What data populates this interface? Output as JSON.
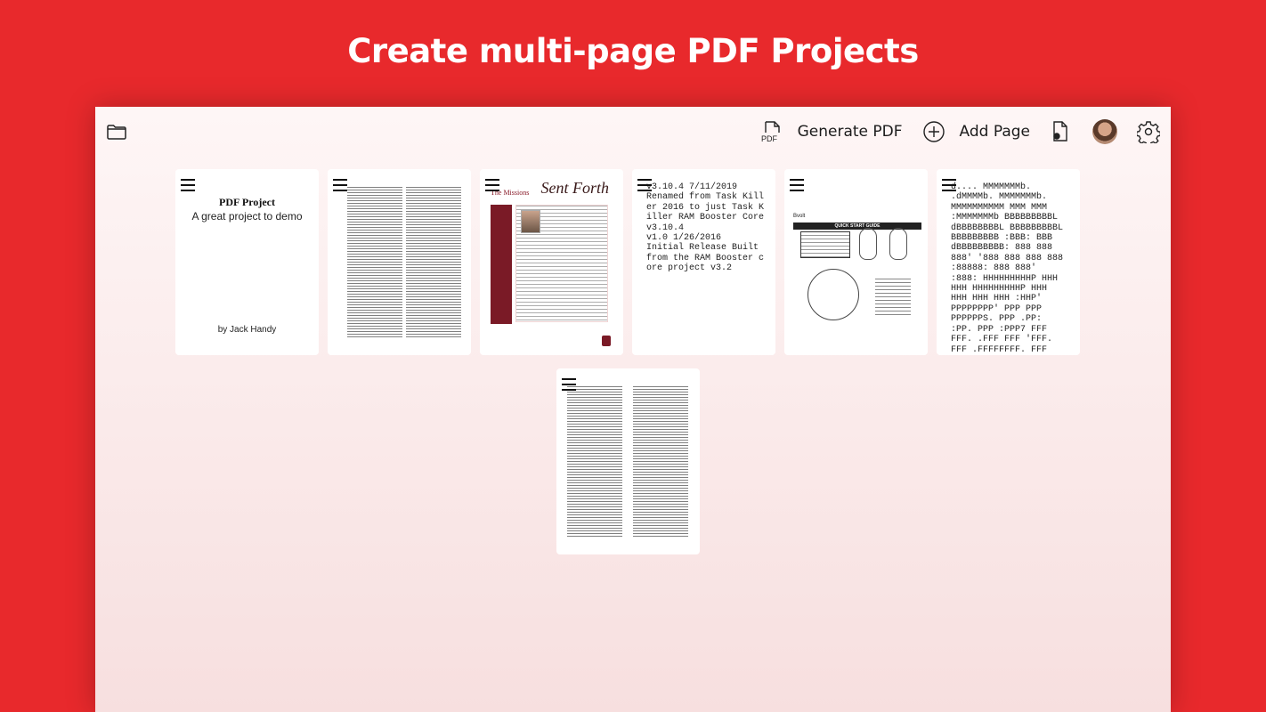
{
  "headline": "Create multi-page PDF Projects",
  "toolbar": {
    "generate_pdf_label": "Generate PDF",
    "add_page_label": "Add Page",
    "pdf_icon_text": "PDF"
  },
  "pages": {
    "p1": {
      "title": "PDF Project",
      "subtitle": "A great project to demo",
      "author": "by Jack Handy"
    },
    "p3": {
      "brand": "The Missions",
      "title": "Sent Forth"
    },
    "p4": {
      "text": "v3.10.4 7/11/2019\nRenamed from Task Killer 2016 to just Task Killer RAM Booster Core v3.10.4\nv1.0 1/26/2016\nInitial Release Built from the RAM Booster core project v3.2"
    },
    "p5": {
      "brand": "Bvolt",
      "banner": "QUICK START GUIDE"
    },
    "p6": {
      "text": "d.... MMMMMMMb.\n.dMMMMb. MMMMMMMb.\nMMMMMMMMMM MMM MMM\n:MMMMMMMb BBBBBBBBBL\ndBBBBBBBBL BBBBBBBBBL\nBBBBBBBBB :BBB: BBB\ndBBBBBBBBB: 888 888\n888' '888 888 888 888\n:88888: 888 888'\n:888: HHHHHHHHHP HHH\nHHH HHHHHHHHHP HHH\nHHH HHH HHH :HHP'\nPPPPPPPP' PPP PPP\nPPPPPPS. PPP .PP:\n:PP. PPP :PPP7 FFF\nFFF. .FFF FFF 'FFF.\nFFF .FFFFFFFF. FFF"
    }
  },
  "colors": {
    "background": "#e8292c",
    "accent": "#7a1a26"
  },
  "icons": [
    "folder-icon",
    "pdf-file-icon",
    "add-circle-icon",
    "file-settings-icon",
    "user-avatar",
    "gear-icon",
    "drag-handle-icon"
  ]
}
